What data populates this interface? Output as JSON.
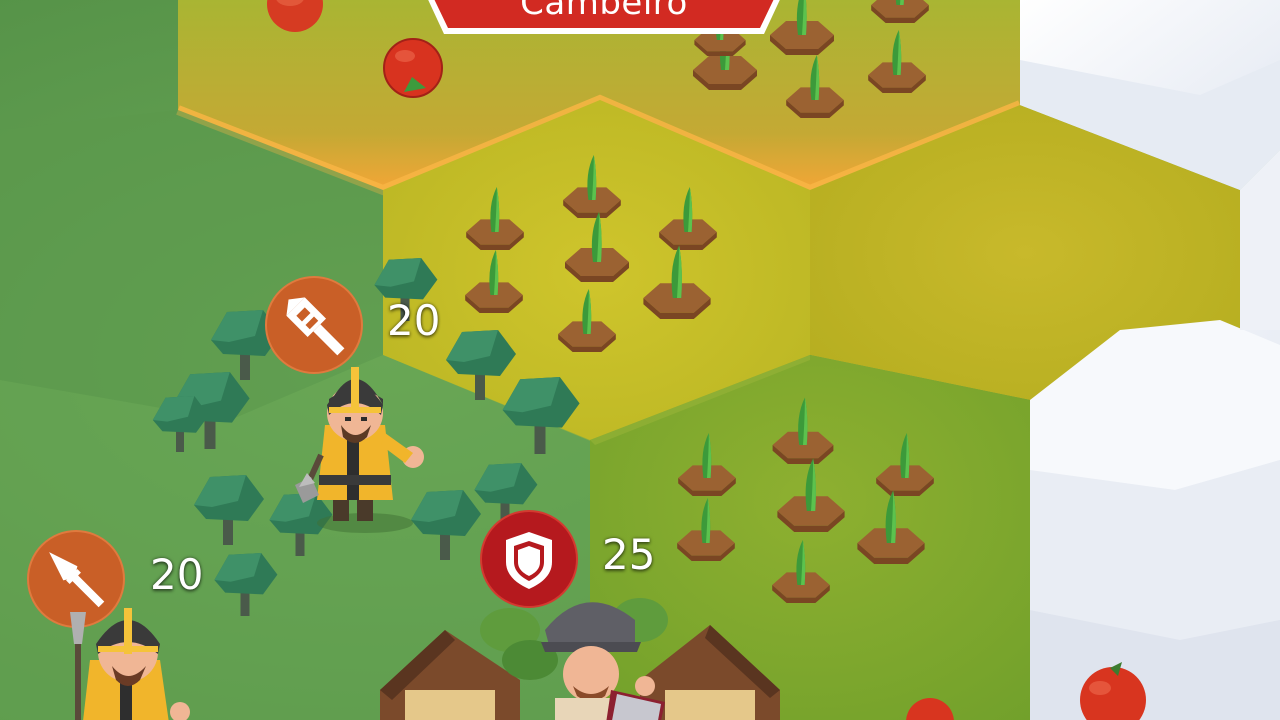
{
  "city": {
    "name": "Cambeiro"
  },
  "units": [
    {
      "type": "mace",
      "health": "20"
    },
    {
      "type": "spear",
      "health": "20"
    },
    {
      "type": "shield",
      "health": "25"
    }
  ],
  "colors": {
    "grass": "#5f9a4e",
    "field": "#c8c12a",
    "city_territory_border": "#f3a637",
    "cloud": "#eef2f8",
    "banner_red": "#d22a22",
    "unit_badge_orange": "#c95f27",
    "unit_badge_red": "#b5191e"
  }
}
